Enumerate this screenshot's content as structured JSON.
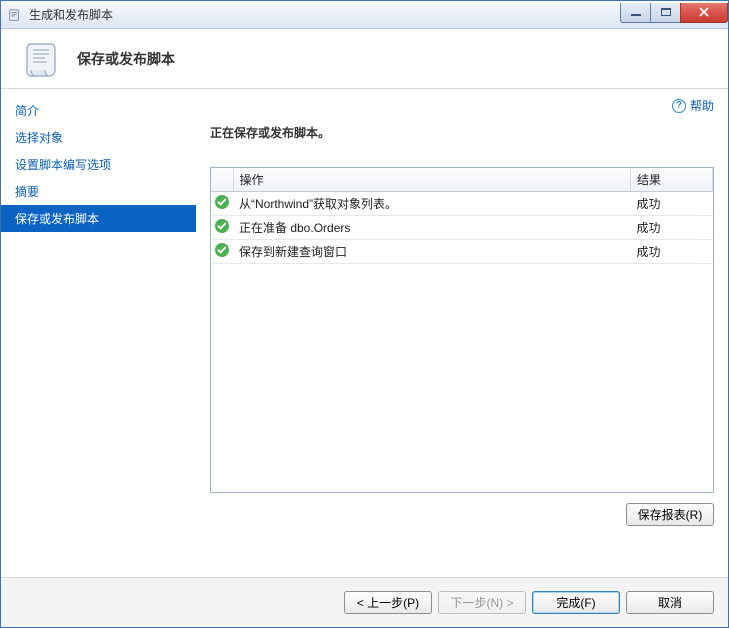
{
  "window": {
    "title": "生成和发布脚本"
  },
  "header": {
    "title": "保存或发布脚本"
  },
  "sidebar": {
    "items": [
      {
        "label": "简介",
        "active": false
      },
      {
        "label": "选择对象",
        "active": false
      },
      {
        "label": "设置脚本编写选项",
        "active": false
      },
      {
        "label": "摘要",
        "active": false
      },
      {
        "label": "保存或发布脚本",
        "active": true
      }
    ]
  },
  "help": {
    "label": "帮助"
  },
  "content": {
    "status_heading": "正在保存或发布脚本。",
    "columns": {
      "action": "操作",
      "result": "结果"
    },
    "rows": [
      {
        "action": "从“Northwind”获取对象列表。",
        "result": "成功"
      },
      {
        "action": "正在准备 dbo.Orders",
        "result": "成功"
      },
      {
        "action": "保存到新建查询窗口",
        "result": "成功"
      }
    ],
    "save_report_label": "保存报表(R)"
  },
  "footer": {
    "back": "< 上一步(P)",
    "next": "下一步(N) >",
    "finish": "完成(F)",
    "cancel": "取消"
  }
}
